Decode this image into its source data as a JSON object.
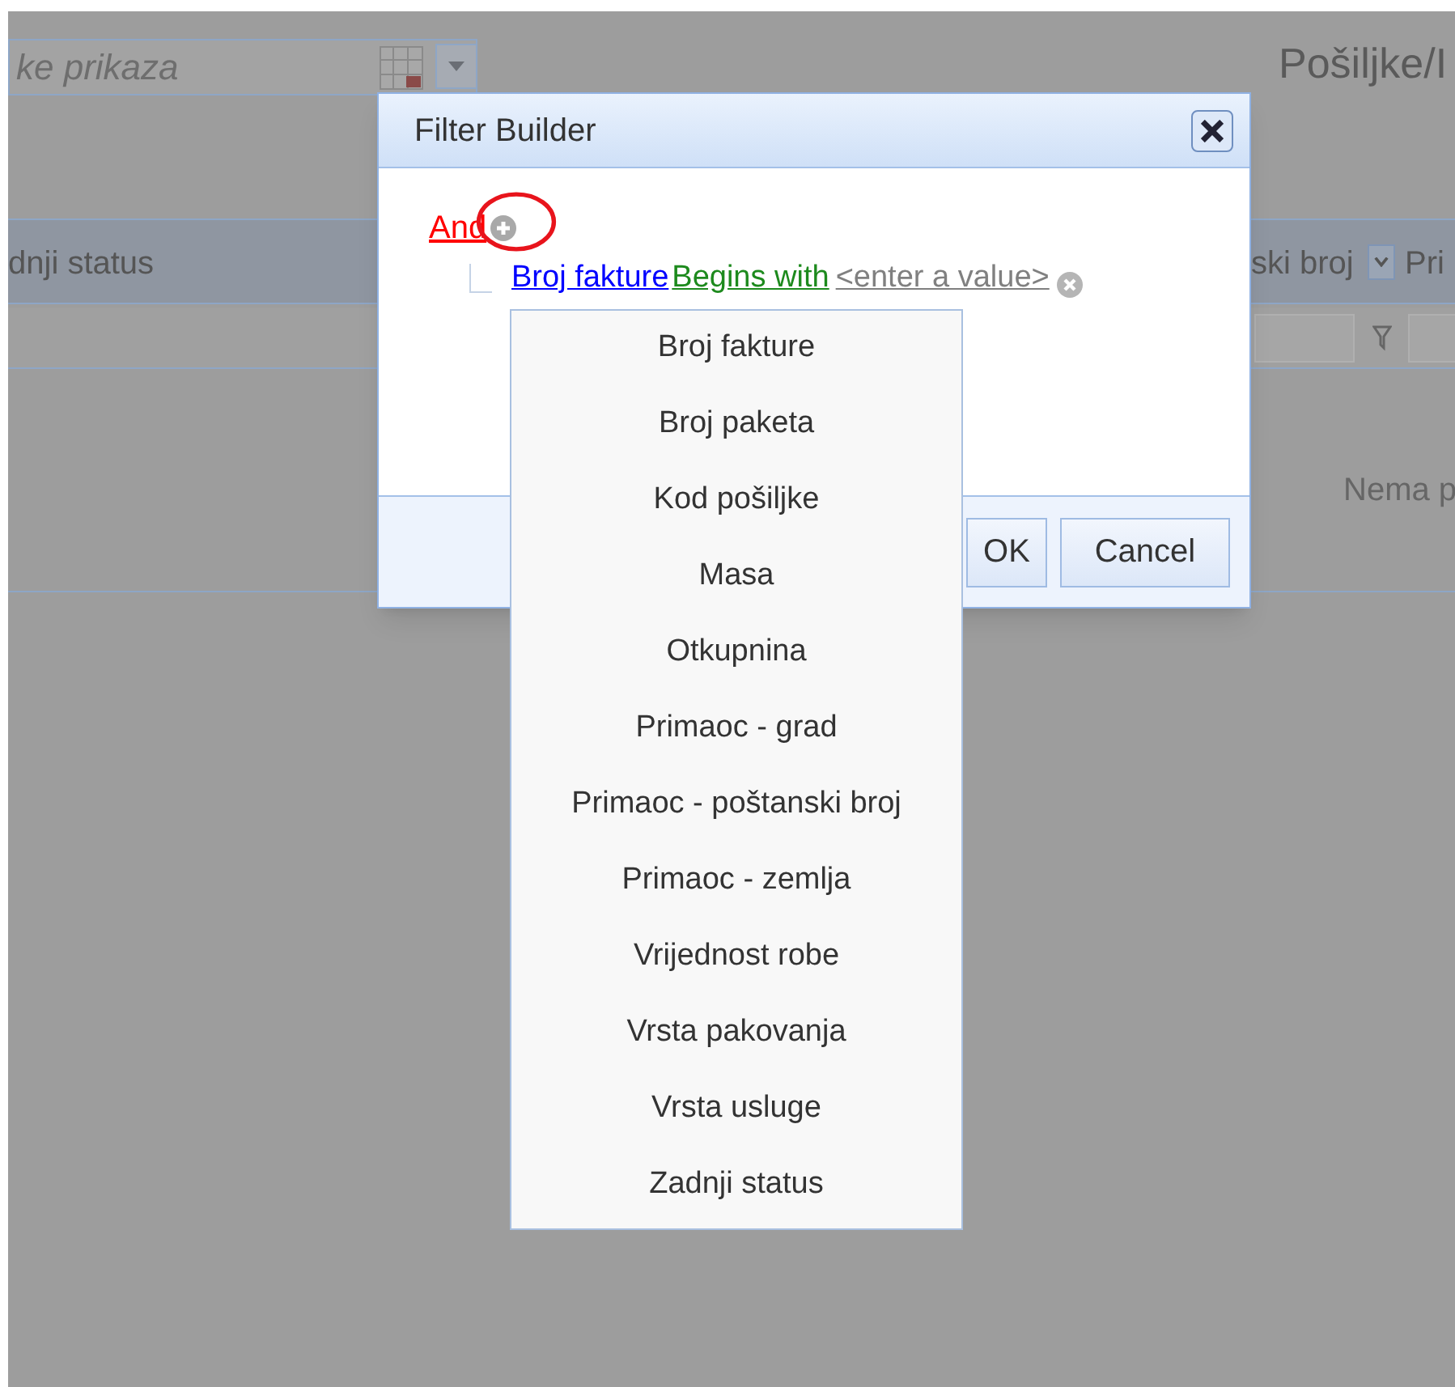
{
  "page": {
    "search": {
      "placeholder": "ke prikaza"
    },
    "title": "Pošiljke/I",
    "grid": {
      "columns": [
        "dnji status",
        "ski broj",
        "Pri"
      ]
    },
    "empty_text": "Nema p"
  },
  "dialog": {
    "title": "Filter Builder",
    "group_operator": "And",
    "conditions": [
      {
        "field": "Broj fakture",
        "operator": "Begins with",
        "value_placeholder": "<enter a value>"
      }
    ],
    "buttons": [
      "OK",
      "Cancel"
    ]
  },
  "field_menu": {
    "items": [
      "Broj fakture",
      "Broj paketa",
      "Kod pošiljke",
      "Masa",
      "Otkupnina",
      "Primaoc - grad",
      "Primaoc - poštanski broj",
      "Primaoc - zemlja",
      "Vrijednost robe",
      "Vrsta pakovanja",
      "Vrsta usluge",
      "Zadnji status"
    ]
  }
}
